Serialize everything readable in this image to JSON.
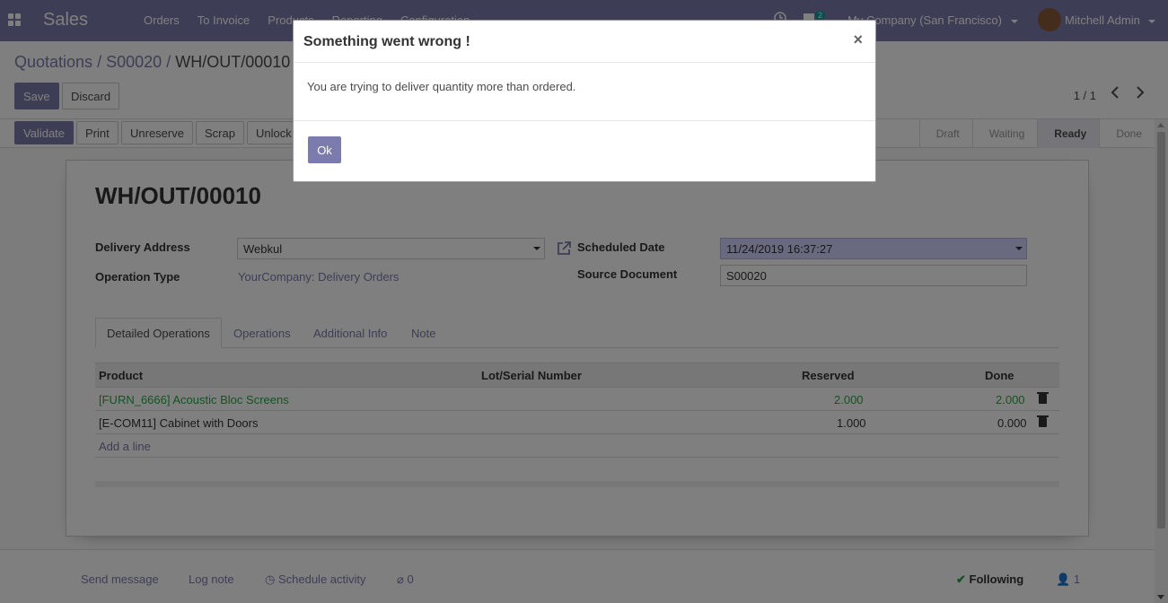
{
  "navbar": {
    "app_name": "Sales",
    "menu": [
      "Orders",
      "To Invoice",
      "Products",
      "Reporting",
      "Configuration"
    ],
    "chat_count": "2",
    "company": "My Company (San Francisco)",
    "user": "Mitchell Admin"
  },
  "breadcrumb": {
    "items": [
      "Quotations",
      "S00020"
    ],
    "separator": "/",
    "current": "WH/OUT/00010"
  },
  "control": {
    "save_label": "Save",
    "discard_label": "Discard",
    "pager": "1 / 1"
  },
  "actions": [
    "Validate",
    "Print",
    "Unreserve",
    "Scrap",
    "Unlock"
  ],
  "stages": [
    {
      "label": "Draft",
      "active": false
    },
    {
      "label": "Waiting",
      "active": false
    },
    {
      "label": "Ready",
      "active": true
    },
    {
      "label": "Done",
      "active": false
    }
  ],
  "record": {
    "title": "WH/OUT/00010",
    "delivery_address_label": "Delivery Address",
    "delivery_address": "Webkul",
    "operation_type_label": "Operation Type",
    "operation_type": "YourCompany: Delivery Orders",
    "scheduled_date_label": "Scheduled Date",
    "scheduled_date": "11/24/2019 16:37:27",
    "source_document_label": "Source Document",
    "source_document": "S00020"
  },
  "tabs": [
    "Detailed Operations",
    "Operations",
    "Additional Info",
    "Note"
  ],
  "table": {
    "headers": [
      "Product",
      "Lot/Serial Number",
      "Reserved",
      "Done"
    ],
    "rows": [
      {
        "product": "[FURN_6666] Acoustic Bloc Screens",
        "lot": "",
        "reserved": "2.000",
        "done": "2.000",
        "highlight": true
      },
      {
        "product": "[E-COM11] Cabinet with Doors",
        "lot": "",
        "reserved": "1.000",
        "done": "0.000",
        "highlight": false
      }
    ],
    "add_line": "Add a line"
  },
  "chatter": {
    "send_message": "Send message",
    "log_note": "Log note",
    "schedule_activity": "Schedule activity",
    "attachments": "0",
    "following": "Following",
    "followers": "1"
  },
  "modal": {
    "title": "Something went wrong !",
    "close": "×",
    "message": "You are trying to deliver quantity more than ordered.",
    "ok_label": "Ok"
  },
  "colors": {
    "brand": "#7c7bad",
    "success": "#28a745"
  }
}
